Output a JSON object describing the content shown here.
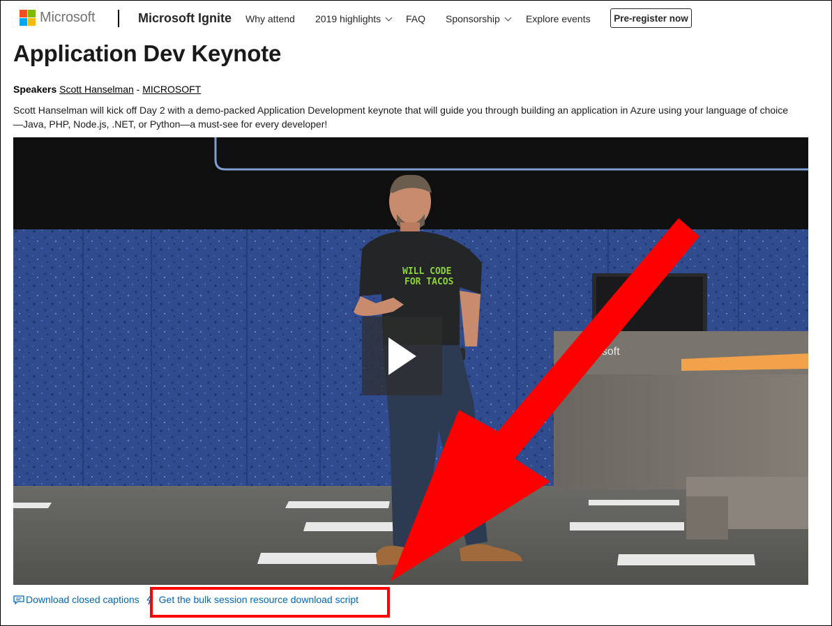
{
  "header": {
    "logo_text": "Microsoft",
    "site_name": "Microsoft Ignite",
    "nav": [
      {
        "label": "Why attend"
      },
      {
        "label": "2019 highlights"
      },
      {
        "label": "FAQ"
      },
      {
        "label": "Sponsorship"
      },
      {
        "label": "Explore events"
      }
    ],
    "cta_label": "Pre-register now"
  },
  "session": {
    "title": "Application Dev Keynote",
    "speakers_label": "Speakers",
    "speaker_name": "Scott Hanselman",
    "separator": " - ",
    "speaker_company": "MICROSOFT",
    "description": "Scott Hanselman will kick off Day 2 with a demo-packed Application Development keynote that will guide you through building an application in Azure using your language of choice—Java, PHP, Node.js, .NET, or Python—a must-see for every developer!"
  },
  "video": {
    "shirt_line1": "WILL CODE",
    "shirt_line2": "FOR TACOS",
    "podium_text": "osoft"
  },
  "links": {
    "captions": "Download closed captions",
    "script": "Get the bulk session resource download script"
  },
  "colors": {
    "link": "#0067b8",
    "annotation": "#ff0000",
    "ms_red": "#f25022",
    "ms_green": "#7fba00",
    "ms_blue": "#00a4ef",
    "ms_yellow": "#ffb900"
  }
}
